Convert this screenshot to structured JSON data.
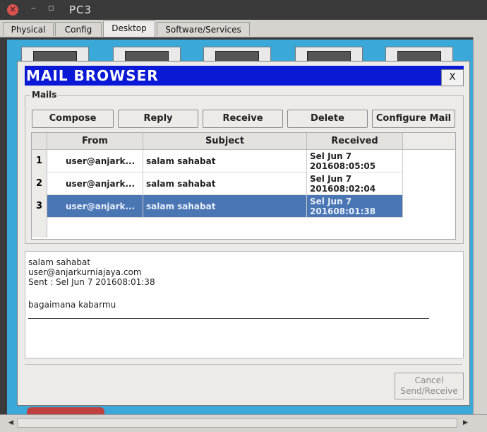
{
  "window": {
    "title": "PC3"
  },
  "tabs": [
    {
      "label": "Physical"
    },
    {
      "label": "Config"
    },
    {
      "label": "Desktop",
      "active": true
    },
    {
      "label": "Software/Services"
    }
  ],
  "dialog": {
    "title": "MAIL BROWSER",
    "close_label": "X",
    "group_label": "Mails",
    "buttons": {
      "compose": "Compose",
      "reply": "Reply",
      "receive": "Receive",
      "delete": "Delete",
      "configure": "Configure Mail"
    },
    "table": {
      "headers": {
        "from": "From",
        "subject": "Subject",
        "received": "Received"
      },
      "rows": [
        {
          "num": "1",
          "from": "user@anjark...",
          "subject": "salam sahabat",
          "received_1": "Sel Jun 7",
          "received_2": "201608:05:05"
        },
        {
          "num": "2",
          "from": "user@anjark...",
          "subject": "salam sahabat",
          "received_1": "Sel Jun 7",
          "received_2": "201608:02:04"
        },
        {
          "num": "3",
          "from": "user@anjark...",
          "subject": "salam sahabat",
          "received_1": "Sel Jun 7",
          "received_2": "201608:01:38",
          "selected": true
        }
      ]
    },
    "message": {
      "subject": "salam sahabat",
      "from": "user@anjarkurniajaya.com",
      "sent": "Sent : Sel Jun 7 201608:01:38",
      "body": "bagaimana kabarmu"
    },
    "cancel_label_1": "Cancel",
    "cancel_label_2": "Send/Receive"
  },
  "colors": {
    "title_bar": "#0a19d6",
    "selected_row": "#4a76b4",
    "desktop_bg": "#3aa9d9"
  }
}
